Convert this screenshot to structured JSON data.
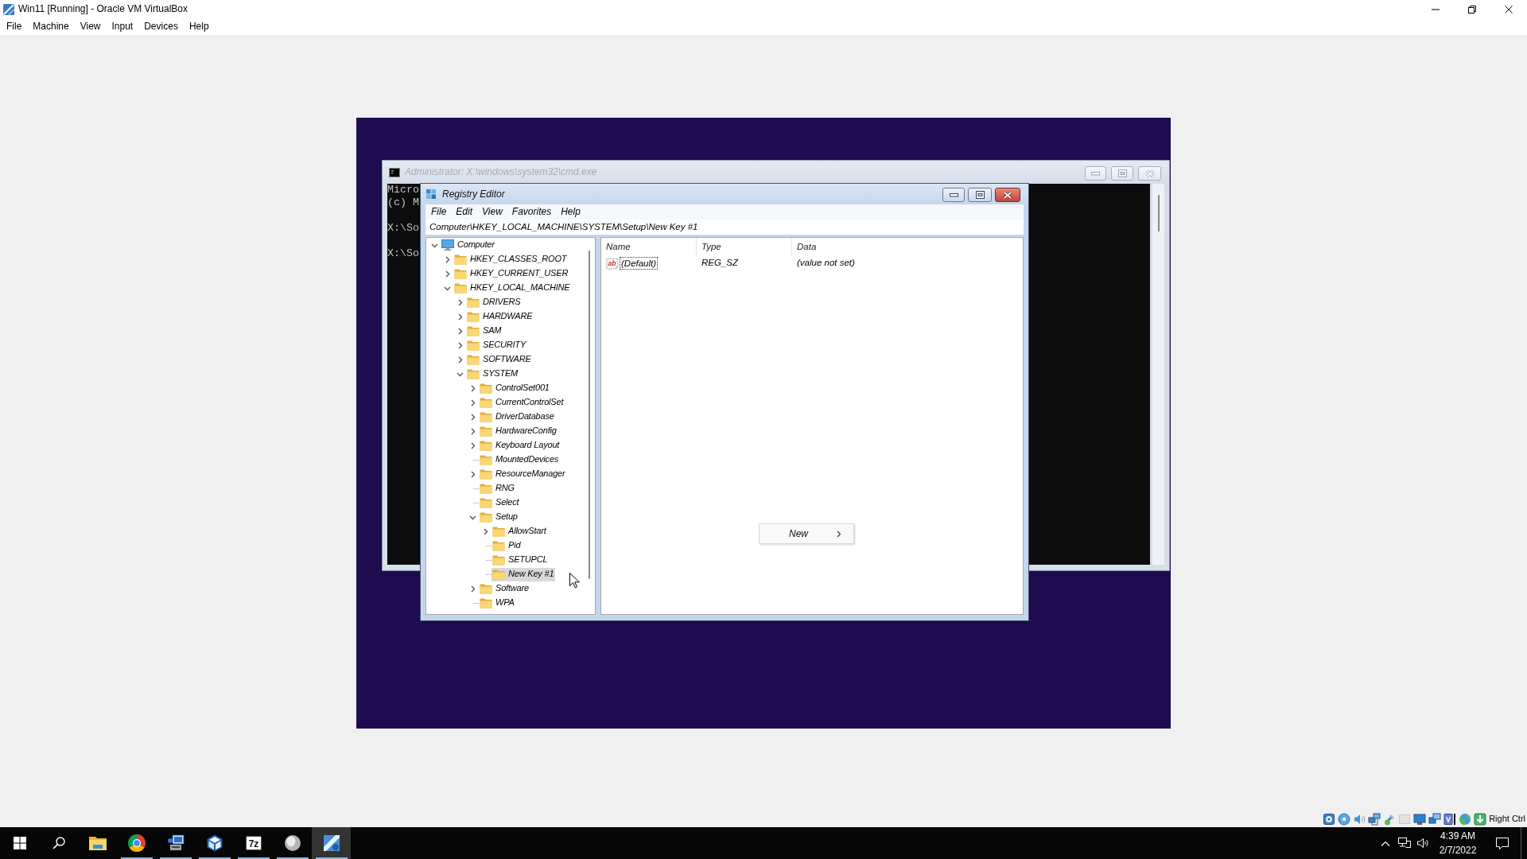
{
  "window": {
    "title": "Win11 [Running] - Oracle VM VirtualBox"
  },
  "menu": [
    "File",
    "Machine",
    "View",
    "Input",
    "Devices",
    "Help"
  ],
  "vm": {
    "console": {
      "title": "Administrator: X:\\windows\\system32\\cmd.exe",
      "active": false,
      "blocks": [
        [
          "Micro",
          "(c) M"
        ],
        [
          "X:\\So"
        ],
        [
          "X:\\So"
        ]
      ]
    },
    "registry_editor": {
      "title": "Registry Editor",
      "active": true,
      "menu": [
        "File",
        "Edit",
        "View",
        "Favorites",
        "Help"
      ],
      "address": "Computer\\HKEY_LOCAL_MACHINE\\SYSTEM\\Setup\\New Key #1",
      "tree": {
        "label": "Computer",
        "expandable": true,
        "expanded": true,
        "selected": false,
        "children": [
          {
            "label": "HKEY_CLASSES_ROOT",
            "expandable": true,
            "expanded": false,
            "selected": false
          },
          {
            "label": "HKEY_CURRENT_USER",
            "expandable": true,
            "expanded": false,
            "selected": false
          },
          {
            "label": "HKEY_LOCAL_MACHINE",
            "expandable": true,
            "expanded": true,
            "selected": false,
            "children": [
              {
                "label": "DRIVERS",
                "expandable": true,
                "expanded": false,
                "selected": false
              },
              {
                "label": "HARDWARE",
                "expandable": true,
                "expanded": false,
                "selected": false
              },
              {
                "label": "SAM",
                "expandable": true,
                "expanded": false,
                "selected": false
              },
              {
                "label": "SECURITY",
                "expandable": true,
                "expanded": false,
                "selected": false
              },
              {
                "label": "SOFTWARE",
                "expandable": true,
                "expanded": false,
                "selected": false
              },
              {
                "label": "SYSTEM",
                "expandable": true,
                "expanded": true,
                "selected": false,
                "children": [
                  {
                    "label": "ControlSet001",
                    "expandable": true,
                    "expanded": false,
                    "selected": false
                  },
                  {
                    "label": "CurrentControlSet",
                    "expandable": true,
                    "expanded": false,
                    "selected": false
                  },
                  {
                    "label": "DriverDatabase",
                    "expandable": true,
                    "expanded": false,
                    "selected": false
                  },
                  {
                    "label": "HardwareConfig",
                    "expandable": true,
                    "expanded": false,
                    "selected": false
                  },
                  {
                    "label": "Keyboard Layout",
                    "expandable": true,
                    "expanded": false,
                    "selected": false
                  },
                  {
                    "label": "MountedDevices",
                    "expandable": false,
                    "expanded": false,
                    "selected": false
                  },
                  {
                    "label": "ResourceManager",
                    "expandable": true,
                    "expanded": false,
                    "selected": false
                  },
                  {
                    "label": "RNG",
                    "expandable": false,
                    "expanded": false,
                    "selected": false
                  },
                  {
                    "label": "Select",
                    "expandable": false,
                    "expanded": false,
                    "selected": false
                  },
                  {
                    "label": "Setup",
                    "expandable": true,
                    "expanded": true,
                    "selected": false,
                    "children": [
                      {
                        "label": "AllowStart",
                        "expandable": true,
                        "expanded": false,
                        "selected": false
                      },
                      {
                        "label": "Pid",
                        "expandable": false,
                        "expanded": false,
                        "selected": false
                      },
                      {
                        "label": "SETUPCL",
                        "expandable": false,
                        "expanded": false,
                        "selected": false
                      },
                      {
                        "label": "New Key #1",
                        "expandable": false,
                        "expanded": false,
                        "selected": true
                      }
                    ]
                  },
                  {
                    "label": "Software",
                    "expandable": true,
                    "expanded": false,
                    "selected": false
                  },
                  {
                    "label": "WPA",
                    "expandable": false,
                    "expanded": false,
                    "selected": false
                  }
                ]
              }
            ]
          }
        ]
      },
      "values": {
        "columns": [
          "Name",
          "Type",
          "Data"
        ],
        "rows": [
          {
            "icon_label": "ab",
            "name": "(Default)",
            "type": "REG_SZ",
            "data": "(value not set)",
            "focused": true
          }
        ]
      },
      "context_menu": {
        "items": [
          {
            "label": "New",
            "submenu": true
          }
        ]
      }
    }
  },
  "status_bar": {
    "host_key": "Right Ctrl"
  },
  "taskbar": {
    "apps": [
      {
        "kind": "explorer",
        "running": false,
        "selected": false
      },
      {
        "kind": "browser",
        "running": true,
        "selected": false
      },
      {
        "kind": "installer",
        "running": true,
        "selected": false
      },
      {
        "kind": "cube",
        "running": true,
        "selected": false
      },
      {
        "kind": "archiver",
        "glyph": "7z",
        "running": true,
        "selected": false
      },
      {
        "kind": "sphere",
        "running": true,
        "selected": false
      },
      {
        "kind": "vm",
        "running": true,
        "selected": true
      }
    ],
    "tray": {
      "time": "4:39 AM",
      "date": "2/7/2022"
    }
  }
}
